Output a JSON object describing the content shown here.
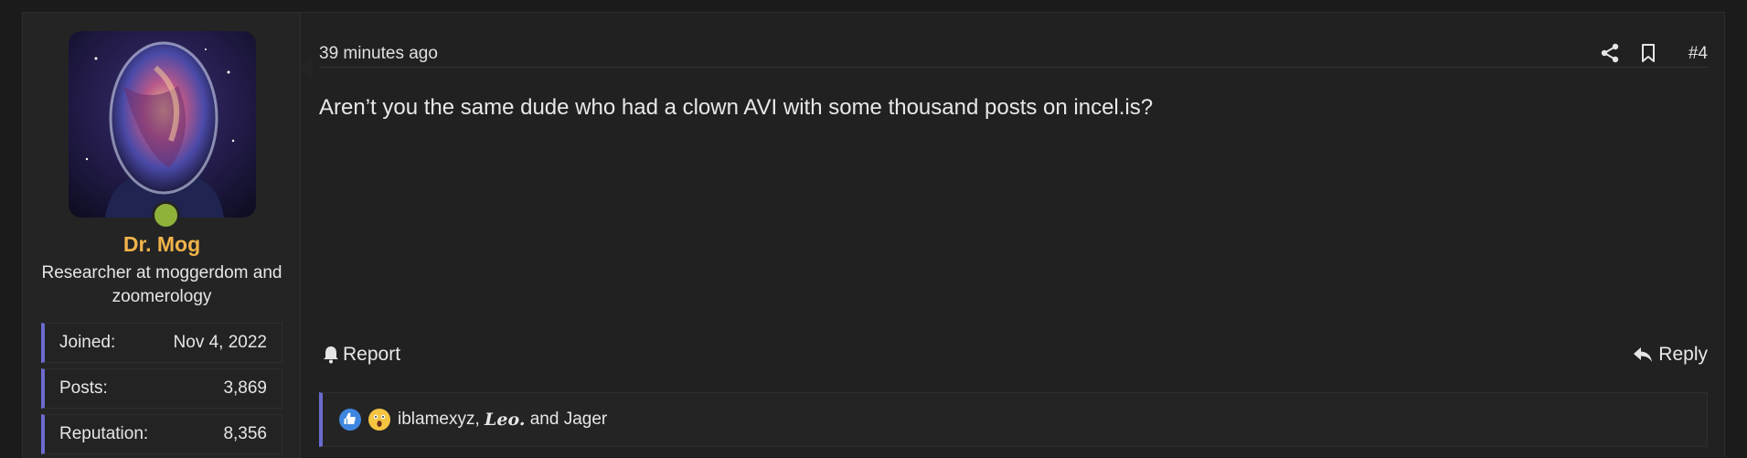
{
  "user": {
    "name": "Dr. Mog",
    "title": "Researcher at moggerdom and zoomerology",
    "stats": [
      {
        "label": "Joined:",
        "value": "Nov 4, 2022"
      },
      {
        "label": "Posts:",
        "value": "3,869"
      },
      {
        "label": "Reputation:",
        "value": "8,356"
      }
    ],
    "avatar_icon": "galaxy-head-avatar",
    "online": true
  },
  "post": {
    "timestamp": "39 minutes ago",
    "number": "#4",
    "message": "Aren’t you the same dude who had a clown AVI with some thousand posts on incel.is?"
  },
  "actions": {
    "report_label": "Report",
    "reply_label": "Reply"
  },
  "reactions": {
    "users": [
      "iblamexyz",
      "Leo."
    ],
    "separator": ",",
    "conjunction": "and",
    "last_user": "Jager",
    "icons": [
      "like-icon",
      "wow-icon"
    ]
  },
  "colors": {
    "username": "#f0b34a",
    "accent": "#6b6bd0",
    "online": "#8fb23b"
  }
}
